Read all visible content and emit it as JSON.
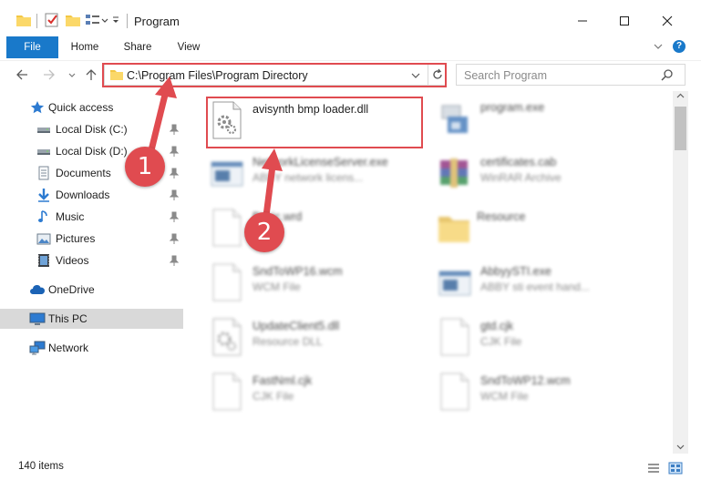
{
  "window": {
    "title": "Program",
    "controls": [
      "minimize",
      "maximize",
      "close"
    ]
  },
  "ribbon": {
    "tabs": [
      "File",
      "Home",
      "Share",
      "View"
    ],
    "help_label": "?"
  },
  "address": {
    "path": "C:\\Program Files\\Program Directory",
    "search_placeholder": "Search Program"
  },
  "nav": {
    "items": [
      {
        "label": "Quick access",
        "icon": "star-icon",
        "pinned": false
      },
      {
        "label": "Local Disk (C:)",
        "icon": "drive-icon",
        "pinned": true
      },
      {
        "label": "Local Disk (D:)",
        "icon": "drive-icon",
        "pinned": true
      },
      {
        "label": "Documents",
        "icon": "documents-icon",
        "pinned": true
      },
      {
        "label": "Downloads",
        "icon": "download-icon",
        "pinned": true
      },
      {
        "label": "Music",
        "icon": "music-icon",
        "pinned": true
      },
      {
        "label": "Pictures",
        "icon": "pictures-icon",
        "pinned": true
      },
      {
        "label": "Videos",
        "icon": "videos-icon",
        "pinned": true
      },
      {
        "label": "OneDrive",
        "icon": "cloud-icon",
        "pinned": false
      },
      {
        "label": "This PC",
        "icon": "computer-icon",
        "pinned": false,
        "selected": true
      },
      {
        "label": "Network",
        "icon": "network-icon",
        "pinned": false
      }
    ]
  },
  "files": [
    {
      "name": "avisynth bmp loader.dll",
      "type": "",
      "icon": "dll-gear-icon",
      "selected": true
    },
    {
      "name": "program.exe",
      "type": "",
      "icon": "exe-icon"
    },
    {
      "name": "NetworkLicenseServer.exe",
      "type": "ABBY network licens...",
      "icon": "window-app-icon"
    },
    {
      "name": "certificates.cab",
      "type": "WinRAR Archive",
      "icon": "winrar-icon"
    },
    {
      "name": "Basic.wrd",
      "type": "File",
      "icon": "blank-file-icon"
    },
    {
      "name": "Resource",
      "type": "",
      "icon": "folder-icon"
    },
    {
      "name": "SndToWP16.wcm",
      "type": "WCM File",
      "icon": "blank-file-icon"
    },
    {
      "name": "AbbyySTI.exe",
      "type": "ABBY sti event hand...",
      "icon": "window-app-icon"
    },
    {
      "name": "UpdateClient5.dll",
      "type": "Resource DLL",
      "icon": "dll-gear-icon"
    },
    {
      "name": "gtd.cjk",
      "type": "CJK File",
      "icon": "blank-file-icon"
    },
    {
      "name": "FastNml.cjk",
      "type": "CJK File",
      "icon": "blank-file-icon"
    },
    {
      "name": "SndToWP12.wcm",
      "type": "WCM File",
      "icon": "blank-file-icon"
    }
  ],
  "status": {
    "item_count": "140 items"
  },
  "annotations": {
    "step1": "1",
    "step2": "2"
  },
  "colors": {
    "accent": "#1979ca",
    "highlight": "#e04b50",
    "selected_nav": "#d9d9d9"
  }
}
